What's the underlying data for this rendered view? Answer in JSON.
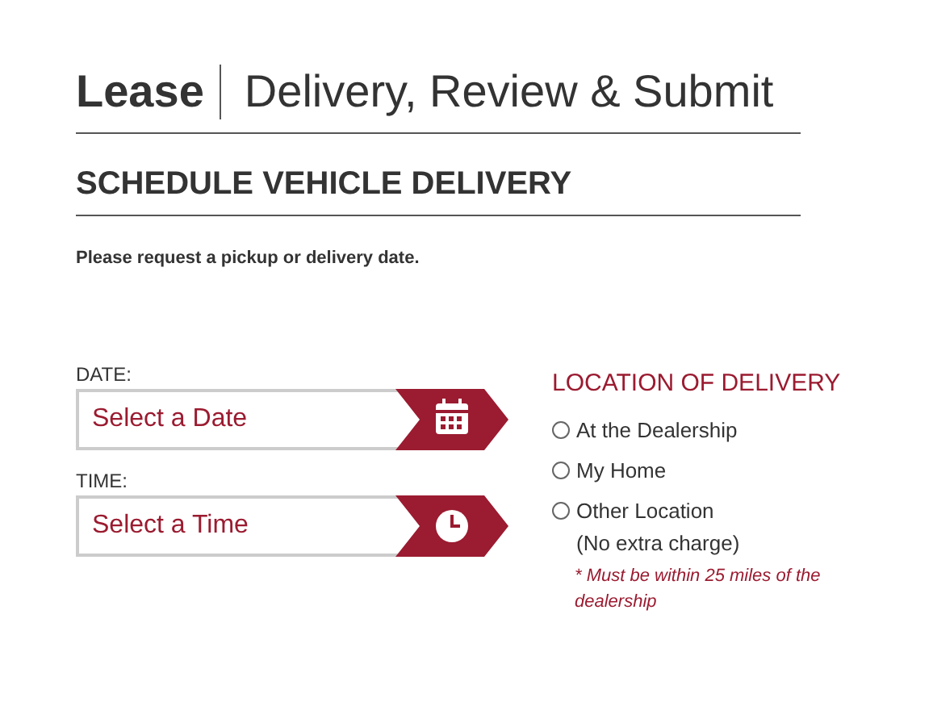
{
  "header": {
    "product": "Lease",
    "step": "Delivery, Review & Submit"
  },
  "section": {
    "title": "SCHEDULE VEHICLE DELIVERY",
    "instruction": "Please request a pickup or delivery date."
  },
  "pickers": [
    {
      "kind": "date",
      "label": "DATE:",
      "placeholder": "Select a Date"
    },
    {
      "kind": "time",
      "label": "TIME:",
      "placeholder": "Select a Time"
    }
  ],
  "location": {
    "title": "LOCATION OF DELIVERY",
    "options": [
      {
        "label": "At the Dealership",
        "selected": false
      },
      {
        "label": "My Home",
        "selected": false
      },
      {
        "label": "Other Location",
        "detail": "(No extra charge)",
        "selected": false
      }
    ],
    "note": "* Must be within 25 miles of the dealership"
  }
}
